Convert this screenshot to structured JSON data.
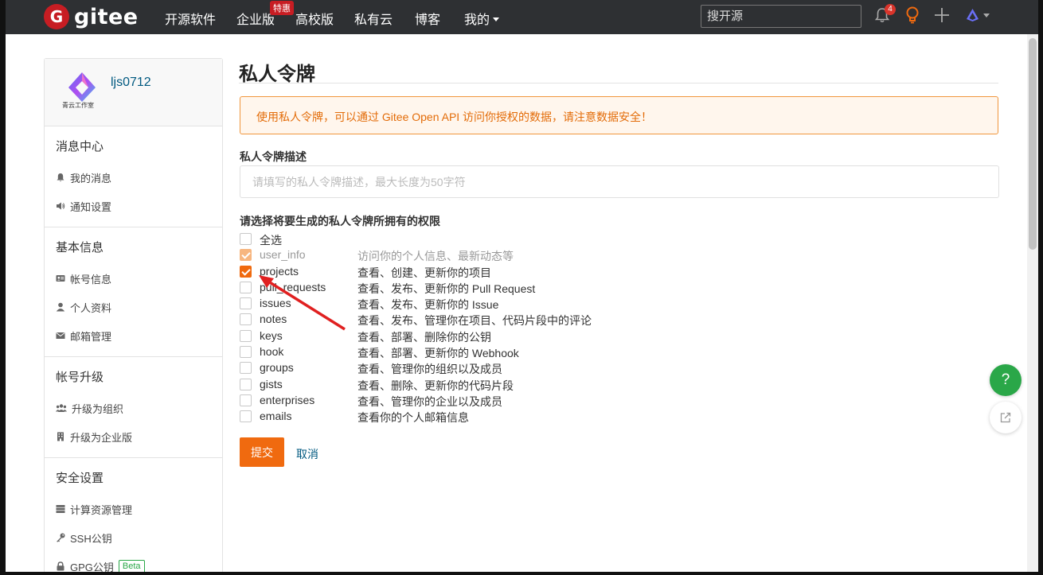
{
  "nav": {
    "logo_text": "gitee",
    "logo_letter": "G",
    "links": [
      "开源软件",
      "企业版",
      "高校版",
      "私有云",
      "博客",
      "我的"
    ],
    "hot_badge": "特惠",
    "search_placeholder": "搜开源",
    "notification_count": "4"
  },
  "sidebar": {
    "username": "ljs0712",
    "avatar_caption": "青云工作室",
    "sections": [
      {
        "heading": "消息中心",
        "items": [
          {
            "label": "我的消息",
            "icon": "bell-icon"
          },
          {
            "label": "通知设置",
            "icon": "speaker-icon"
          }
        ]
      },
      {
        "heading": "基本信息",
        "items": [
          {
            "label": "帐号信息",
            "icon": "id-card-icon"
          },
          {
            "label": "个人资料",
            "icon": "user-icon"
          },
          {
            "label": "邮箱管理",
            "icon": "envelope-icon"
          }
        ]
      },
      {
        "heading": "帐号升级",
        "items": [
          {
            "label": "升级为组织",
            "icon": "group-icon"
          },
          {
            "label": "升级为企业版",
            "icon": "building-icon"
          }
        ]
      },
      {
        "heading": "安全设置",
        "items": [
          {
            "label": "计算资源管理",
            "icon": "server-icon"
          },
          {
            "label": "SSH公钥",
            "icon": "key-icon"
          },
          {
            "label": "GPG公钥",
            "icon": "lock-icon",
            "badge": "Beta"
          }
        ]
      }
    ]
  },
  "main": {
    "title": "私人令牌",
    "notice": "使用私人令牌，可以通过 Gitee Open API 访问你授权的数据，请注意数据安全！",
    "desc_label": "私人令牌描述",
    "desc_placeholder": "请填写的私人令牌描述，最大长度为50字符",
    "perm_label": "请选择将要生成的私人令牌所拥有的权限",
    "select_all": "全选",
    "permissions": [
      {
        "name": "user_info",
        "desc": "访问你的个人信息、最新动态等",
        "state": "disabled"
      },
      {
        "name": "projects",
        "desc": "查看、创建、更新你的项目",
        "state": "checked"
      },
      {
        "name": "pull_requests",
        "desc": "查看、发布、更新你的 Pull Request",
        "state": "unchecked"
      },
      {
        "name": "issues",
        "desc": "查看、发布、更新你的 Issue",
        "state": "unchecked"
      },
      {
        "name": "notes",
        "desc": "查看、发布、管理你在项目、代码片段中的评论",
        "state": "unchecked"
      },
      {
        "name": "keys",
        "desc": "查看、部署、删除你的公钥",
        "state": "unchecked"
      },
      {
        "name": "hook",
        "desc": "查看、部署、更新你的 Webhook",
        "state": "unchecked"
      },
      {
        "name": "groups",
        "desc": "查看、管理你的组织以及成员",
        "state": "unchecked"
      },
      {
        "name": "gists",
        "desc": "查看、删除、更新你的代码片段",
        "state": "unchecked"
      },
      {
        "name": "enterprises",
        "desc": "查看、管理你的企业以及成员",
        "state": "unchecked"
      },
      {
        "name": "emails",
        "desc": "查看你的个人邮箱信息",
        "state": "unchecked"
      }
    ],
    "submit_label": "提交",
    "cancel_label": "取消"
  },
  "floating": {
    "help_label": "?"
  },
  "colors": {
    "brand": "#c71d23",
    "accent": "#f06a0f",
    "link": "#005980",
    "help": "#2aa748"
  }
}
